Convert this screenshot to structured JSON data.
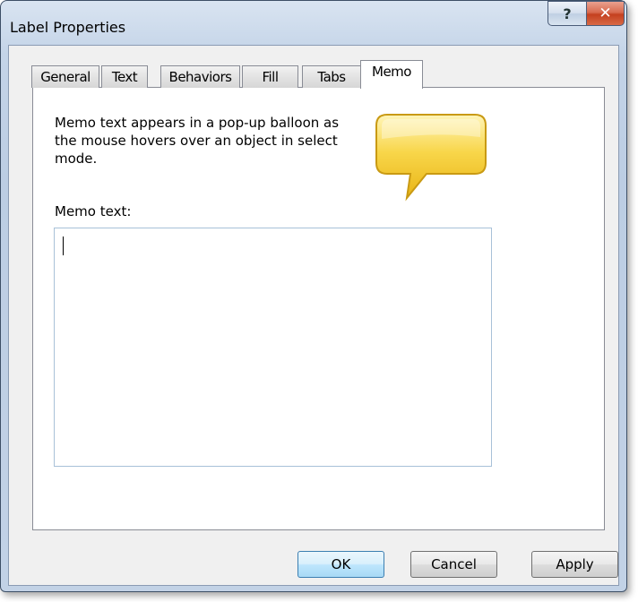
{
  "window": {
    "title": "Label Properties",
    "help_glyph": "?",
    "close_glyph": "✕"
  },
  "tabs": [
    {
      "label": "General",
      "active": false
    },
    {
      "label": "Text",
      "active": false
    },
    {
      "label": "Behaviors",
      "active": false
    },
    {
      "label": "Fill",
      "active": false
    },
    {
      "label": "Tabs",
      "active": false
    },
    {
      "label": "Memo",
      "active": true
    }
  ],
  "memo": {
    "description": "Memo text appears in a pop-up balloon as the mouse hovers over an object in select mode.",
    "field_label": "Memo text:",
    "value": "",
    "illustration_icon": "speech-balloon-icon"
  },
  "buttons": {
    "ok": "OK",
    "cancel": "Cancel",
    "apply": "Apply"
  },
  "colors": {
    "balloon_fill": "#f8d64a",
    "close_button": "#c8452a",
    "default_button_border": "#3c7fb1"
  }
}
